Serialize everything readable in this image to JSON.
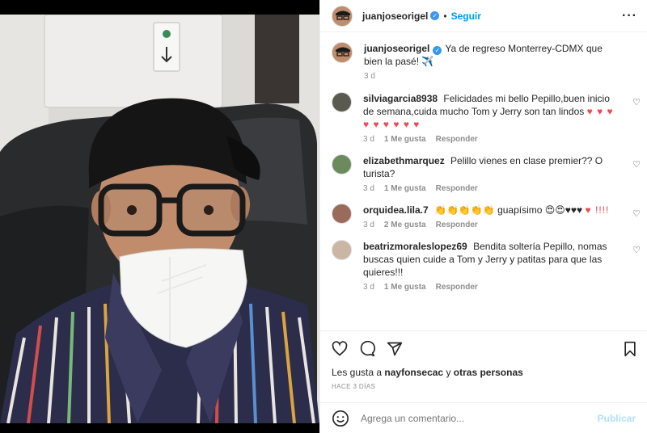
{
  "post": {
    "author": "juanjoseorigel",
    "follow_label": "Seguir",
    "caption": "Ya de regreso Monterrey-CDMX que bien la pasé! ✈️",
    "caption_time": "3 d"
  },
  "comments": [
    {
      "user": "silviagarcia8938",
      "text": "Felicidades mi bello Pepillo,buen inicio de semana,cuida mucho Tom y Jerry son tan lindos",
      "emoji": "♥ ♥ ♥ ♥ ♥ ♥ ♥ ♥ ♥",
      "time": "3 d",
      "likes": "1 Me gusta",
      "reply": "Responder",
      "avatar_color": "#5a5a50"
    },
    {
      "user": "elizabethmarquez",
      "text": "Pelillo vienes en clase premier?? O turista?",
      "emoji": "",
      "time": "3 d",
      "likes": "1 Me gusta",
      "reply": "Responder",
      "avatar_color": "#6b8a5e"
    },
    {
      "user": "orquidea.lila.7",
      "text": "👏👏👏👏👏 guapísimo 😍😍♥♥♥",
      "emoji": "♥ !!!!",
      "time": "3 d",
      "likes": "2 Me gusta",
      "reply": "Responder",
      "avatar_color": "#9a6a5a"
    },
    {
      "user": "beatrizmoraleslopez69",
      "text": "Bendita soltería Pepillo, nomas buscas quien cuide a Tom y Jerry y patitas para que las quieres!!!",
      "emoji": "",
      "time": "3 d",
      "likes": "1 Me gusta",
      "reply": "Responder",
      "avatar_color": "#c9b7a4"
    }
  ],
  "likes": {
    "prefix": "Les gusta a",
    "user": "nayfonsecac",
    "conj": "y",
    "others": "otras personas"
  },
  "timestamp": "HACE 3 DÍAS",
  "composer": {
    "placeholder": "Agrega un comentario...",
    "post_label": "Publicar"
  },
  "icons": {
    "like": "heart-icon",
    "comment": "comment-icon",
    "share": "share-icon",
    "save": "bookmark-icon",
    "emoji": "emoji-icon",
    "more": "more-icon"
  },
  "colors": {
    "accent": "#0095f6",
    "verified": "#3897f0",
    "heart": "#ed4956",
    "muted": "#8e8e8e"
  },
  "photo": {
    "sign_text": "!"
  }
}
